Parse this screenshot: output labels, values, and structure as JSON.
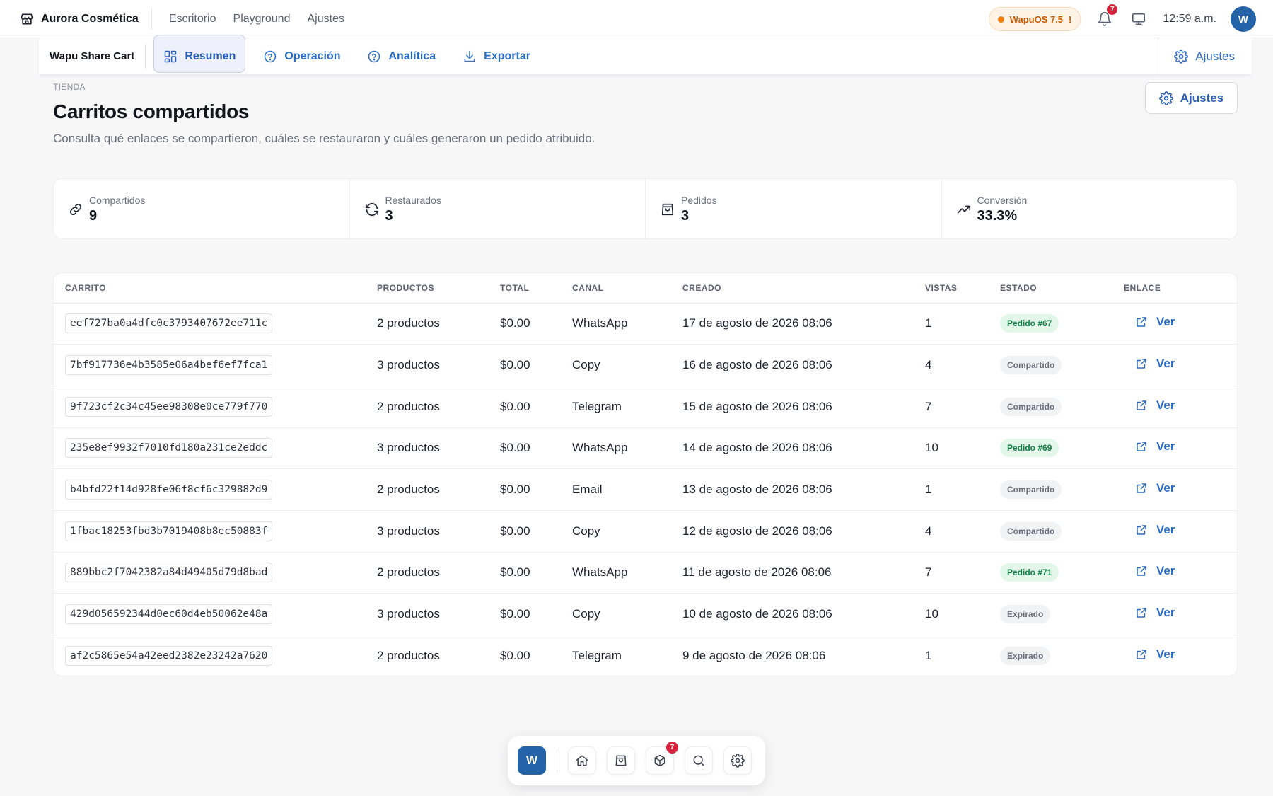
{
  "topbar": {
    "store_name": "Aurora Cosmética",
    "nav": [
      "Escritorio",
      "Playground",
      "Ajustes"
    ],
    "version_label": "WapuOS 7.5",
    "version_alert": "!",
    "notifications_count": "7",
    "clock": "12:59 a.m.",
    "avatar_initial": "W"
  },
  "subnav": {
    "title": "Wapu Share Cart",
    "tabs": [
      "Resumen",
      "Operación",
      "Analítica",
      "Exportar"
    ],
    "active_tab": "Resumen",
    "settings_label": "Ajustes"
  },
  "page": {
    "eyebrow": "TIENDA",
    "title": "Carritos compartidos",
    "subtitle": "Consulta qué enlaces se compartieron, cuáles se restauraron y cuáles generaron un pedido atribuido.",
    "settings_button": "Ajustes"
  },
  "stats": [
    {
      "label": "Compartidos",
      "value": "9",
      "icon": "link-icon"
    },
    {
      "label": "Restaurados",
      "value": "3",
      "icon": "refresh-icon"
    },
    {
      "label": "Pedidos",
      "value": "3",
      "icon": "bag-icon"
    },
    {
      "label": "Conversión",
      "value": "33.3%",
      "icon": "trending-up-icon"
    }
  ],
  "table": {
    "headers": [
      "CARRITO",
      "PRODUCTOS",
      "TOTAL",
      "CANAL",
      "CREADO",
      "VISTAS",
      "ESTADO",
      "ENLACE"
    ],
    "rows": [
      {
        "cart": "eef727ba0a4dfc0c3793407672ee711c",
        "products": "2 productos",
        "total": "$0.00",
        "channel": "WhatsApp",
        "created": "17 de agosto de 2026 08:06",
        "views": "1",
        "status": "Pedido #67",
        "status_color": "#13834a",
        "link": "Ver"
      },
      {
        "cart": "7bf917736e4b3585e06a4bef6ef7fca1",
        "products": "3 productos",
        "total": "$0.00",
        "channel": "Copy",
        "created": "16 de agosto de 2026 08:06",
        "views": "4",
        "status": "Compartido",
        "status_color": "#6a6f7c",
        "link": "Ver"
      },
      {
        "cart": "9f723cf2c34c45ee98308e0ce779f770",
        "products": "2 productos",
        "total": "$0.00",
        "channel": "Telegram",
        "created": "15 de agosto de 2026 08:06",
        "views": "7",
        "status": "Compartido",
        "status_color": "#6a6f7c",
        "link": "Ver"
      },
      {
        "cart": "235e8ef9932f7010fd180a231ce2eddc",
        "products": "3 productos",
        "total": "$0.00",
        "channel": "WhatsApp",
        "created": "14 de agosto de 2026 08:06",
        "views": "10",
        "status": "Pedido #69",
        "status_color": "#13834a",
        "link": "Ver"
      },
      {
        "cart": "b4bfd22f14d928fe06f8cf6c329882d9",
        "products": "2 productos",
        "total": "$0.00",
        "channel": "Email",
        "created": "13 de agosto de 2026 08:06",
        "views": "1",
        "status": "Compartido",
        "status_color": "#6a6f7c",
        "link": "Ver"
      },
      {
        "cart": "1fbac18253fbd3b7019408b8ec50883f",
        "products": "3 productos",
        "total": "$0.00",
        "channel": "Copy",
        "created": "12 de agosto de 2026 08:06",
        "views": "4",
        "status": "Compartido",
        "status_color": "#6a6f7c",
        "link": "Ver"
      },
      {
        "cart": "889bbc2f7042382a84d49405d79d8bad",
        "products": "2 productos",
        "total": "$0.00",
        "channel": "WhatsApp",
        "created": "11 de agosto de 2026 08:06",
        "views": "7",
        "status": "Pedido #71",
        "status_color": "#13834a",
        "link": "Ver"
      },
      {
        "cart": "429d056592344d0ec60d4eb50062e48a",
        "products": "3 productos",
        "total": "$0.00",
        "channel": "Copy",
        "created": "10 de agosto de 2026 08:06",
        "views": "10",
        "status": "Expirado",
        "status_color": "#6a6f7c",
        "link": "Ver"
      },
      {
        "cart": "af2c5865e54a42eed2382e23242a7620",
        "products": "2 productos",
        "total": "$0.00",
        "channel": "Telegram",
        "created": "9 de agosto de 2026 08:06",
        "views": "1",
        "status": "Expirado",
        "status_color": "#6a6f7c",
        "link": "Ver"
      }
    ]
  },
  "dock": {
    "logo_initial": "W",
    "items": [
      "home-icon",
      "bag-icon",
      "box-icon",
      "search-icon",
      "gear-icon"
    ],
    "box_badge": "7"
  },
  "colors": {
    "accent": "#2a6cc4",
    "brand": "#2563a8",
    "success_bg": "#e3f6ea",
    "success_text": "#13834a",
    "warning": "#ee7d10",
    "danger": "#d6213b"
  }
}
